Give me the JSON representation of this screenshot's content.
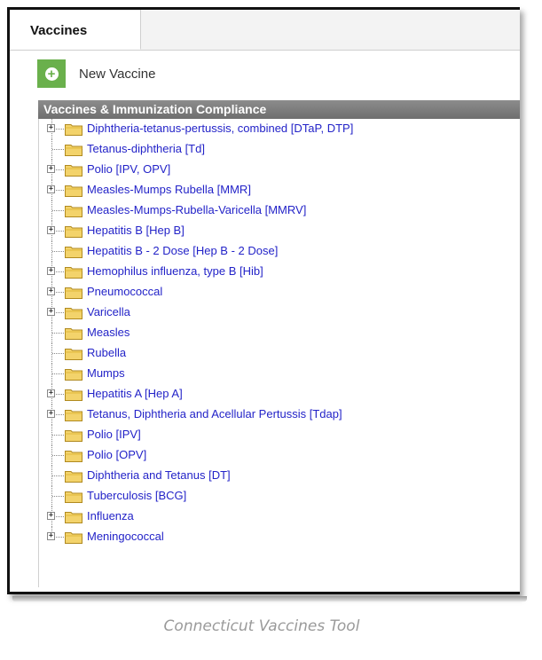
{
  "tab": {
    "label": "Vaccines"
  },
  "toolbar": {
    "new_vaccine_label": "New Vaccine"
  },
  "section": {
    "title": "Vaccines & Immunization Compliance"
  },
  "tree_items": [
    {
      "label": "Diphtheria-tetanus-pertussis, combined [DTaP, DTP]",
      "expandable": true
    },
    {
      "label": "Tetanus-diphtheria [Td]",
      "expandable": false
    },
    {
      "label": "Polio [IPV, OPV]",
      "expandable": true
    },
    {
      "label": "Measles-Mumps Rubella [MMR]",
      "expandable": true
    },
    {
      "label": "Measles-Mumps-Rubella-Varicella [MMRV]",
      "expandable": false
    },
    {
      "label": "Hepatitis B [Hep B]",
      "expandable": true
    },
    {
      "label": "Hepatitis B - 2 Dose [Hep B - 2 Dose]",
      "expandable": false
    },
    {
      "label": "Hemophilus influenza, type B [Hib]",
      "expandable": true
    },
    {
      "label": "Pneumococcal",
      "expandable": true
    },
    {
      "label": "Varicella",
      "expandable": true
    },
    {
      "label": "Measles",
      "expandable": false
    },
    {
      "label": "Rubella",
      "expandable": false
    },
    {
      "label": "Mumps",
      "expandable": false
    },
    {
      "label": "Hepatitis A [Hep A]",
      "expandable": true
    },
    {
      "label": "Tetanus, Diphtheria and Acellular Pertussis [Tdap]",
      "expandable": true
    },
    {
      "label": "Polio [IPV]",
      "expandable": false
    },
    {
      "label": "Polio [OPV]",
      "expandable": false
    },
    {
      "label": "Diphtheria and Tetanus [DT]",
      "expandable": false
    },
    {
      "label": "Tuberculosis [BCG]",
      "expandable": false
    },
    {
      "label": "Influenza",
      "expandable": true
    },
    {
      "label": "Meningococcal",
      "expandable": true
    }
  ],
  "caption": "Connecticut Vaccines Tool",
  "colors": {
    "link": "#2323c8",
    "accent_green": "#6ab04c",
    "header_gray": "#7a7a7a",
    "folder": "#f3d36b"
  }
}
